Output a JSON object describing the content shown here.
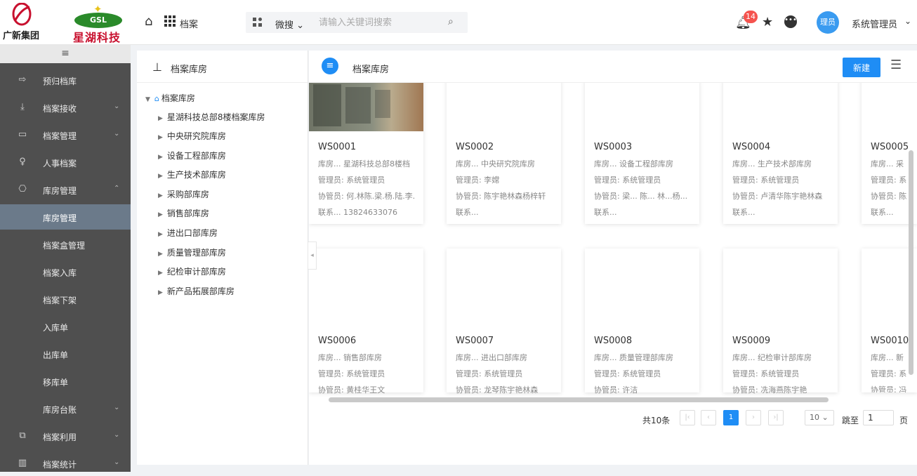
{
  "header": {
    "logo_left_text": "广新集团",
    "logo_right_badge": "GSL",
    "logo_right_text": "星湖科技",
    "app_name": "档案",
    "search_type": "微搜 ⌄",
    "search_placeholder": "请输入关键词搜索",
    "notification_count": "14",
    "avatar_text": "理员",
    "username": "系统管理员",
    "accent_color": "#1f8df5"
  },
  "sidebar": {
    "collapse_symbol": "≡",
    "items": [
      {
        "label": "预归档库",
        "icon": "login-arrow-icon",
        "caret": ""
      },
      {
        "label": "档案接收",
        "icon": "download-icon",
        "caret": "⌄"
      },
      {
        "label": "档案管理",
        "icon": "save-icon",
        "caret": "⌄"
      },
      {
        "label": "人事档案",
        "icon": "person-icon",
        "caret": ""
      },
      {
        "label": "库房管理",
        "icon": "cube-icon",
        "caret": "⌃"
      },
      {
        "label": "库房管理",
        "icon": "",
        "caret": ""
      },
      {
        "label": "档案盒管理",
        "icon": "",
        "caret": ""
      },
      {
        "label": "档案入库",
        "icon": "",
        "caret": ""
      },
      {
        "label": "档案下架",
        "icon": "",
        "caret": ""
      },
      {
        "label": "入库单",
        "icon": "",
        "caret": ""
      },
      {
        "label": "出库单",
        "icon": "",
        "caret": ""
      },
      {
        "label": "移库单",
        "icon": "",
        "caret": ""
      },
      {
        "label": "库房台账",
        "icon": "",
        "caret": "⌄"
      },
      {
        "label": "档案利用",
        "icon": "search-doc-icon",
        "caret": "⌄"
      },
      {
        "label": "档案统计",
        "icon": "bar-chart-icon",
        "caret": "⌄"
      }
    ]
  },
  "tree": {
    "title": "档案库房",
    "root": "档案库房",
    "children": [
      "星湖科技总部8楼档案库房",
      "中央研究院库房",
      "设备工程部库房",
      "生产技术部库房",
      "采购部库房",
      "销售部库房",
      "进出口部库房",
      "质量管理部库房",
      "纪检审计部库房",
      "新产品拓展部库房"
    ]
  },
  "content": {
    "title": "档案库房",
    "new_button": "新建",
    "cards": [
      {
        "code": "WS0001",
        "lines": [
          "库房...  星湖科技总部8楼档",
          "管理员: 系统管理员",
          "协管员: 何.林陈.梁.杨.陆.李.",
          "联系...  13824633076"
        ],
        "has_photo": true
      },
      {
        "code": "WS0002",
        "lines": [
          "库房...  中央研究院库房",
          "管理员: 李嫦",
          "协管员: 陈宇艳林森杨梓轩",
          "联系..."
        ],
        "has_photo": false
      },
      {
        "code": "WS0003",
        "lines": [
          "库房...  设备工程部库房",
          "管理员: 系统管理员",
          "协管员: 梁...  陈...  林...杨...",
          "联系..."
        ],
        "has_photo": false
      },
      {
        "code": "WS0004",
        "lines": [
          "库房...  生产技术部库房",
          "管理员: 系统管理员",
          "协管员: 卢清华陈宇艳林森",
          "联系..."
        ],
        "has_photo": false
      },
      {
        "code": "WS0005",
        "lines": [
          "库房...  采",
          "管理员: 系",
          "协管员: 陈",
          "联系..."
        ],
        "has_photo": false
      },
      {
        "code": "WS0006",
        "lines": [
          "库房...  销售部库房",
          "管理员: 系统管理员",
          "协管员: 黄桂华王文"
        ],
        "has_photo": false
      },
      {
        "code": "WS0007",
        "lines": [
          "库房...  进出口部库房",
          "管理员: 系统管理员",
          "协管员: 龙琴陈宇艳林森"
        ],
        "has_photo": false
      },
      {
        "code": "WS0008",
        "lines": [
          "库房...  质量管理部库房",
          "管理员: 系统管理员",
          "协管员: 许洁"
        ],
        "has_photo": false
      },
      {
        "code": "WS0009",
        "lines": [
          "库房...  纪检审计部库房",
          "管理员: 系统管理员",
          "协管员: 冼海燕陈宇艳"
        ],
        "has_photo": false
      },
      {
        "code": "WS0010",
        "lines": [
          "库房...  新",
          "管理员: 系",
          "协管员: 冯"
        ],
        "has_photo": false
      }
    ]
  },
  "pagination": {
    "total": "共10条",
    "current_page": "1",
    "page_size": "10 ⌄",
    "goto_label": "跳至",
    "goto_value": "1",
    "page_unit": "页"
  }
}
